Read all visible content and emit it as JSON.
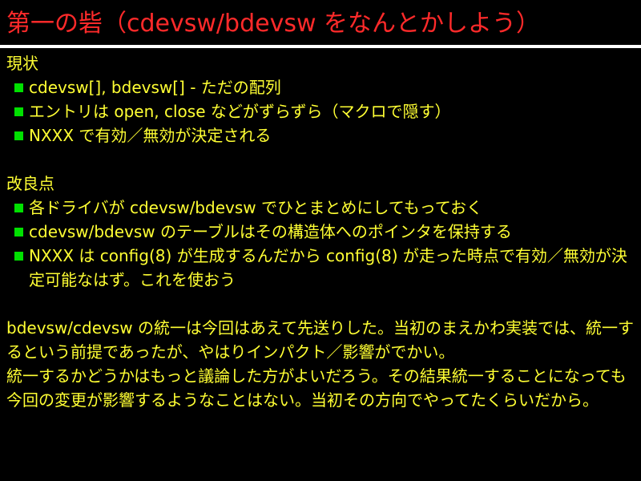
{
  "slide": {
    "title": "第一の砦（cdevsw/bdevsw をなんとかしよう）",
    "sections": [
      {
        "heading": "現状",
        "items": [
          "cdevsw[], bdevsw[] - ただの配列",
          "エントリは open, close などがずらずら（マクロで隠す）",
          "NXXX で有効／無効が決定される"
        ]
      },
      {
        "heading": "改良点",
        "items": [
          "各ドライバが cdevsw/bdevsw でひとまとめにしてもっておく",
          "cdevsw/bdevsw のテーブルはその構造体へのポインタを保持する",
          "NXXX は config(8) が生成するんだから config(8) が走った時点で有効／無効が決定可能なはず。これを使おう"
        ]
      }
    ],
    "paragraphs": [
      "bdevsw/cdevsw の統一は今回はあえて先送りした。当初のまえかわ実装では、統一するという前提であったが、やはりインパクト／影響がでかい。",
      "統一するかどうかはもっと議論した方がよいだろう。その結果統一することになっても今回の変更が影響するようなことはない。当初その方向でやってたくらいだから。"
    ]
  },
  "colors": {
    "background": "#000000",
    "title": "#ff2a2a",
    "rule": "#ffffff",
    "text": "#ffff33",
    "bullet": "#00e000"
  }
}
